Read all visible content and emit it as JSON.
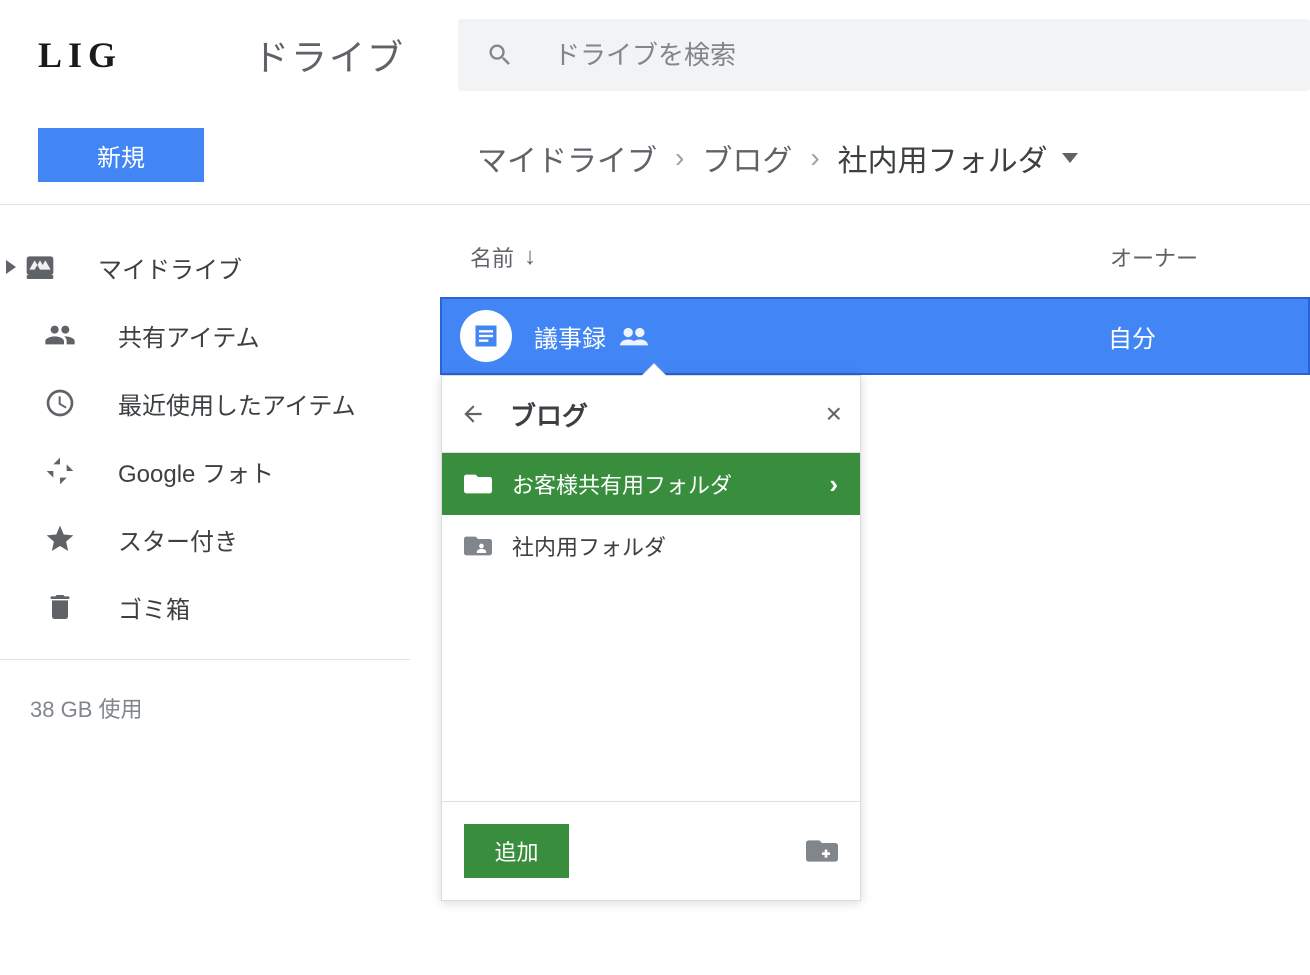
{
  "header": {
    "logo": "LIG",
    "app_title": "ドライブ",
    "search_placeholder": "ドライブを検索"
  },
  "toolbar": {
    "new_label": "新規"
  },
  "breadcrumb": [
    {
      "label": "マイドライブ"
    },
    {
      "label": "ブログ"
    },
    {
      "label": "社内用フォルダ"
    }
  ],
  "sidebar": {
    "items": [
      {
        "icon": "drive",
        "label": "マイドライブ"
      },
      {
        "icon": "people",
        "label": "共有アイテム"
      },
      {
        "icon": "clock",
        "label": "最近使用したアイテム"
      },
      {
        "icon": "photos",
        "label": "Google フォト"
      },
      {
        "icon": "star",
        "label": "スター付き"
      },
      {
        "icon": "trash",
        "label": "ゴミ箱"
      }
    ],
    "storage": "38 GB 使用"
  },
  "files": {
    "header_name": "名前",
    "header_owner": "オーナー",
    "rows": [
      {
        "name": "議事録",
        "owner": "自分",
        "shared": true
      }
    ]
  },
  "popover": {
    "title": "ブログ",
    "items": [
      {
        "label": "お客様共有用フォルダ",
        "selected": true
      },
      {
        "label": "社内用フォルダ",
        "selected": false
      }
    ],
    "add_label": "追加"
  }
}
